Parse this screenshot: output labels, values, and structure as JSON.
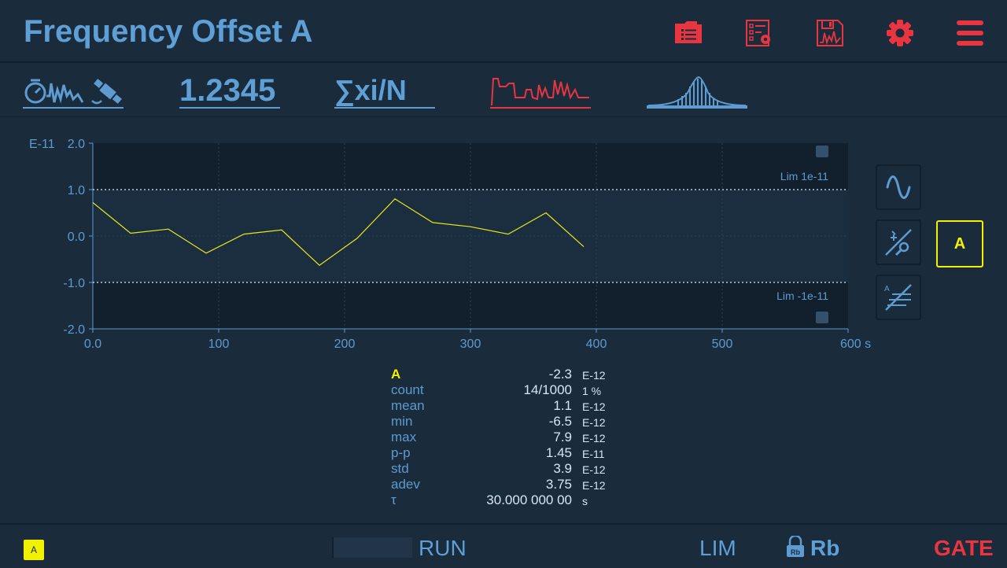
{
  "header": {
    "title": "Frequency Offset A",
    "icons": [
      "folder-list-icon",
      "settings-list-icon",
      "save-waveform-icon",
      "gear-icon",
      "hamburger-menu-icon"
    ]
  },
  "modes": {
    "number_display": "1.2345",
    "statistics": "∑xi/N",
    "items": [
      "timer-signal-satellite-icon",
      "numeric-mode",
      "statistics-mode",
      "time-series-mode",
      "histogram-mode"
    ]
  },
  "colors": {
    "accent": "#5d9bd0",
    "alert": "#e8353f",
    "trace": "#e6e619",
    "channel": "#f2f200"
  },
  "chart_data": {
    "type": "line",
    "y_exponent_label": "E-11",
    "x_unit": "s",
    "xlim": [
      0,
      600
    ],
    "ylim": [
      -2.0,
      2.0
    ],
    "x_ticks": [
      "0.0",
      "100",
      "200",
      "300",
      "400",
      "500",
      "600 s"
    ],
    "y_ticks": [
      "2.0",
      "1.0",
      "0.0",
      "-1.0",
      "-2.0"
    ],
    "limits": [
      {
        "label": "Lim 1e-11",
        "value": 1.0
      },
      {
        "label": "Lim -1e-11",
        "value": -1.0
      }
    ],
    "series": [
      {
        "x": [
          0,
          30,
          60,
          90,
          120,
          150,
          180,
          210,
          240,
          270,
          300,
          330,
          360,
          390
        ],
        "values": [
          0.72,
          0.06,
          0.15,
          -0.37,
          0.04,
          0.13,
          -0.63,
          -0.05,
          0.8,
          0.29,
          0.2,
          0.04,
          0.5,
          -0.23
        ]
      }
    ]
  },
  "side_buttons": {
    "channel_label": "A"
  },
  "stats": {
    "rows": [
      {
        "label": "A",
        "value": "-2.3",
        "unit": "E-12"
      },
      {
        "label": "count",
        "value": "14/1000",
        "unit": "1 %"
      },
      {
        "label": "mean",
        "value": "1.1",
        "unit": "E-12"
      },
      {
        "label": "min",
        "value": "-6.5",
        "unit": "E-12"
      },
      {
        "label": "max",
        "value": "7.9",
        "unit": "E-12"
      },
      {
        "label": "p-p",
        "value": "1.45",
        "unit": "E-11"
      },
      {
        "label": "std",
        "value": "3.9",
        "unit": "E-12"
      },
      {
        "label": "adev",
        "value": "3.75",
        "unit": "E-12"
      },
      {
        "label": "τ",
        "value": "30.000 000 00",
        "unit": "s"
      }
    ]
  },
  "footer": {
    "channel_badge": "A",
    "run_label": "RUN",
    "lim_label": "LIM",
    "rb_small": "Rb",
    "rb_label": "Rb",
    "gate_label": "GATE"
  }
}
